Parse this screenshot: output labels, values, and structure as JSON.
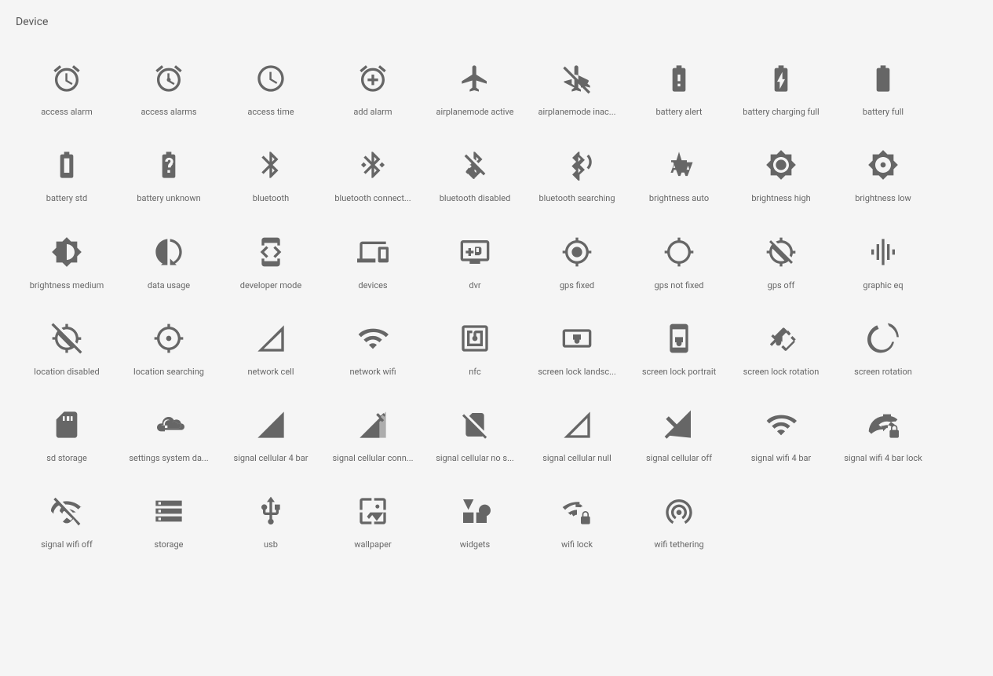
{
  "section": {
    "title": "Device"
  },
  "icons": [
    {
      "name": "access-alarm",
      "label": "access alarm"
    },
    {
      "name": "access-alarms",
      "label": "access alarms"
    },
    {
      "name": "access-time",
      "label": "access time"
    },
    {
      "name": "add-alarm",
      "label": "add alarm"
    },
    {
      "name": "airplanemode-active",
      "label": "airplanemode active"
    },
    {
      "name": "airplanemode-inactive",
      "label": "airplanemode inac..."
    },
    {
      "name": "battery-alert",
      "label": "battery alert"
    },
    {
      "name": "battery-charging-full",
      "label": "battery charging full"
    },
    {
      "name": "battery-full",
      "label": "battery full"
    },
    {
      "name": "battery-std",
      "label": "battery std"
    },
    {
      "name": "battery-unknown",
      "label": "battery unknown"
    },
    {
      "name": "bluetooth",
      "label": "bluetooth"
    },
    {
      "name": "bluetooth-connected",
      "label": "bluetooth connect..."
    },
    {
      "name": "bluetooth-disabled",
      "label": "bluetooth disabled"
    },
    {
      "name": "bluetooth-searching",
      "label": "bluetooth searching"
    },
    {
      "name": "brightness-auto",
      "label": "brightness auto"
    },
    {
      "name": "brightness-high",
      "label": "brightness high"
    },
    {
      "name": "brightness-low",
      "label": "brightness low"
    },
    {
      "name": "brightness-medium",
      "label": "brightness medium"
    },
    {
      "name": "data-usage",
      "label": "data usage"
    },
    {
      "name": "developer-mode",
      "label": "developer mode"
    },
    {
      "name": "devices",
      "label": "devices"
    },
    {
      "name": "dvr",
      "label": "dvr"
    },
    {
      "name": "gps-fixed",
      "label": "gps fixed"
    },
    {
      "name": "gps-not-fixed",
      "label": "gps not fixed"
    },
    {
      "name": "gps-off",
      "label": "gps off"
    },
    {
      "name": "graphic-eq",
      "label": "graphic eq"
    },
    {
      "name": "location-disabled",
      "label": "location disabled"
    },
    {
      "name": "location-searching",
      "label": "location searching"
    },
    {
      "name": "network-cell",
      "label": "network cell"
    },
    {
      "name": "network-wifi",
      "label": "network wifi"
    },
    {
      "name": "nfc",
      "label": "nfc"
    },
    {
      "name": "screen-lock-landscape",
      "label": "screen lock landsc..."
    },
    {
      "name": "screen-lock-portrait",
      "label": "screen lock portrait"
    },
    {
      "name": "screen-lock-rotation",
      "label": "screen lock rotation"
    },
    {
      "name": "screen-rotation",
      "label": "screen rotation"
    },
    {
      "name": "sd-storage",
      "label": "sd storage"
    },
    {
      "name": "settings-system-daydream",
      "label": "settings system da..."
    },
    {
      "name": "signal-cellular-4bar",
      "label": "signal cellular 4 bar"
    },
    {
      "name": "signal-cellular-connected",
      "label": "signal cellular conn..."
    },
    {
      "name": "signal-cellular-no-sim",
      "label": "signal cellular no s..."
    },
    {
      "name": "signal-cellular-null",
      "label": "signal cellular null"
    },
    {
      "name": "signal-cellular-off",
      "label": "signal cellular off"
    },
    {
      "name": "signal-wifi-4bar",
      "label": "signal wifi 4 bar"
    },
    {
      "name": "signal-wifi-4bar-lock",
      "label": "signal wifi 4 bar lock"
    },
    {
      "name": "signal-wifi-off",
      "label": "signal wifi off"
    },
    {
      "name": "storage",
      "label": "storage"
    },
    {
      "name": "usb",
      "label": "usb"
    },
    {
      "name": "wallpaper",
      "label": "wallpaper"
    },
    {
      "name": "widgets",
      "label": "widgets"
    },
    {
      "name": "wifi-lock",
      "label": "wifi lock"
    },
    {
      "name": "wifi-tethering",
      "label": "wifi tethering"
    }
  ]
}
